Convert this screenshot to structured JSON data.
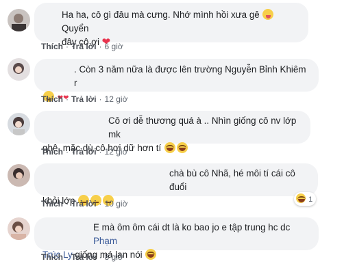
{
  "comments": [
    {
      "text": "Ha ha, cô gì đâu mà cưng. Nhớ mình hồi xưa gê",
      "text2": " Quyển",
      "line2": "đây cô ơi",
      "actions": {
        "like": "Thích",
        "reply": "Trả lời",
        "time": "6 giờ"
      }
    },
    {
      "text": ". Còn 3 năm nữa là được lên trường Nguyễn Bỉnh Khiêm r",
      "actions": {
        "like": "Thích",
        "reply": "Trả lời",
        "time": "12 giờ"
      }
    },
    {
      "line1": "Cô ơi dễ thương quá à .. Nhìn giống cô nv lớp mk",
      "line2": "ghê, mặc dù cô hơi dữ hơn tí",
      "actions": {
        "like": "Thích",
        "reply": "Trả lời",
        "time": "12 giờ"
      }
    },
    {
      "line1": "chà bù cô Nhã, hé môi tí cái cô đuổi",
      "line2": "khỏi lớp",
      "reaction_count": "1",
      "actions": {
        "like": "Thích",
        "reply": "Trả lời",
        "time": "10 giờ"
      }
    },
    {
      "line1": "E mà ôm ôm cái dt là ko bao jo e tập trung hc dc",
      "mention_a": "Phạm",
      "mention_b": "Trúc Ly",
      "line2_rest": " giống má lan nói",
      "actions": {
        "like": "Thích",
        "reply": "Trả lời",
        "time": "8 giờ"
      }
    }
  ],
  "emoji": {
    "c1": [
      "tongue-face",
      "heart"
    ],
    "c2": [
      "smile-face",
      "heart-pair"
    ],
    "c3": [
      "laugh-face",
      "laugh-face"
    ],
    "c4": [
      "neutral-face",
      "neutral-face",
      "neutral-face"
    ],
    "c4_reaction": "laugh-face",
    "c5": [
      "laugh-face"
    ]
  }
}
